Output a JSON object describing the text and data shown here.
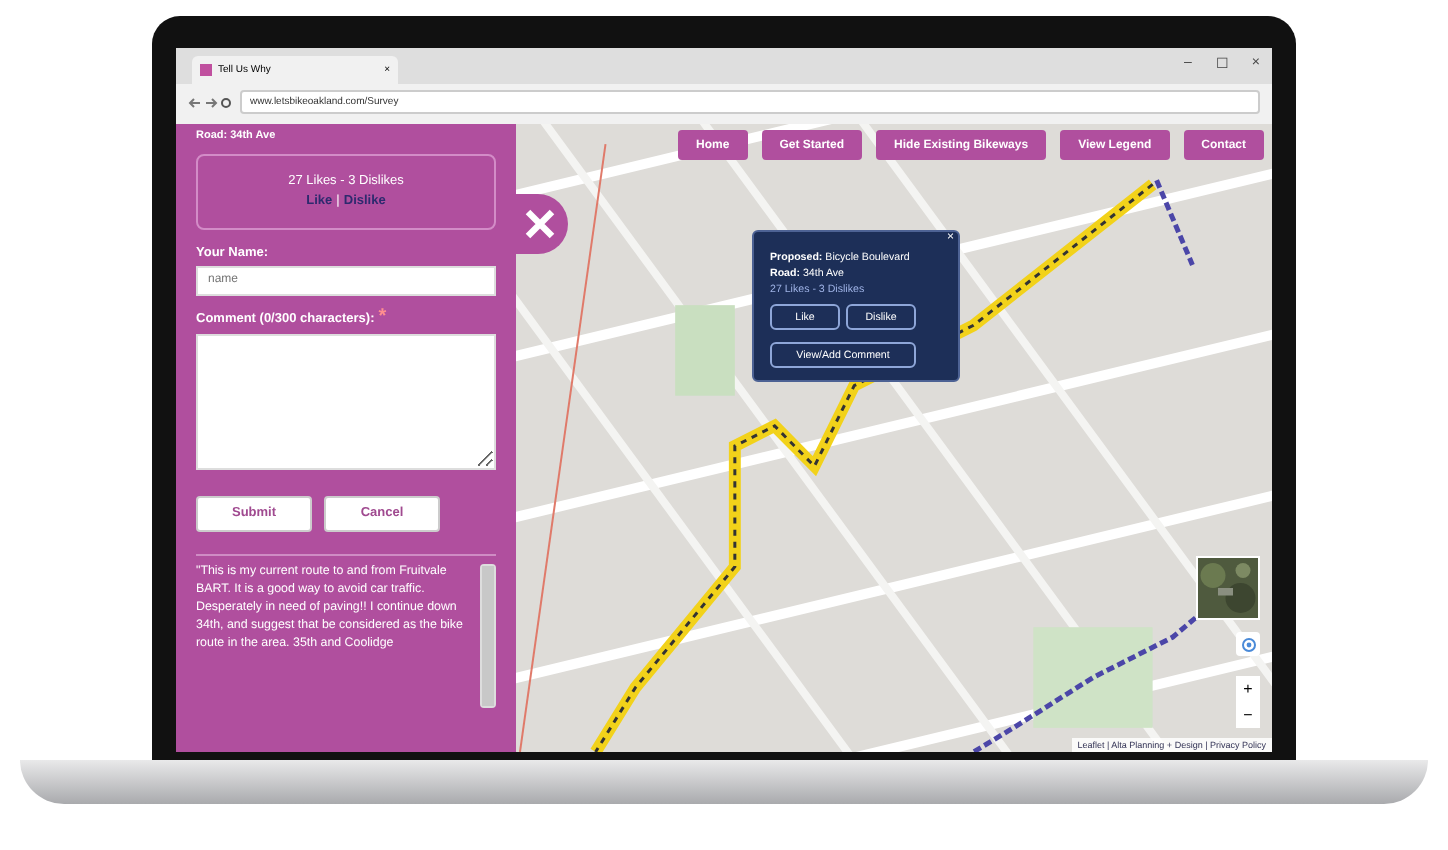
{
  "browser": {
    "tab_title": "Tell Us Why",
    "tab_close": "×",
    "url": "www.letsbikeoakland.com/Survey",
    "window_controls": [
      "–",
      "☐",
      "×"
    ]
  },
  "sidebar": {
    "road": "Road: 34th Ave",
    "votes": "27 Likes - 3 Dislikes",
    "like": "Like",
    "separator": "|",
    "dislike": "Dislike",
    "name_label": "Your Name:",
    "name_placeholder": "name",
    "comment_label": "Comment (0/300 characters):",
    "required_mark": "*",
    "buttons": [
      "Submit",
      "Cancel"
    ],
    "comment": "\"This is my current route to and from Fruitvale BART. It is a good way to avoid car traffic. Desperately in need of paving!! I continue down 34th, and suggest that be considered as the bike route in the area. 35th and Coolidge"
  },
  "nav": [
    "Home",
    "Get Started",
    "Hide Existing Bikeways",
    "View Legend",
    "Contact"
  ],
  "popup": {
    "close": "×",
    "lines": [
      "**Proposed:** Bicycle Boulevard",
      "**Road:** 34th Ave"
    ],
    "votes": "27 Likes - 3 Dislikes",
    "buttons": [
      "Like",
      "Dislike"
    ],
    "view": "View/Add Comment"
  },
  "zoom": [
    "+",
    "−"
  ],
  "attribution": "Leaflet | Alta Planning + Design | Privacy Policy"
}
